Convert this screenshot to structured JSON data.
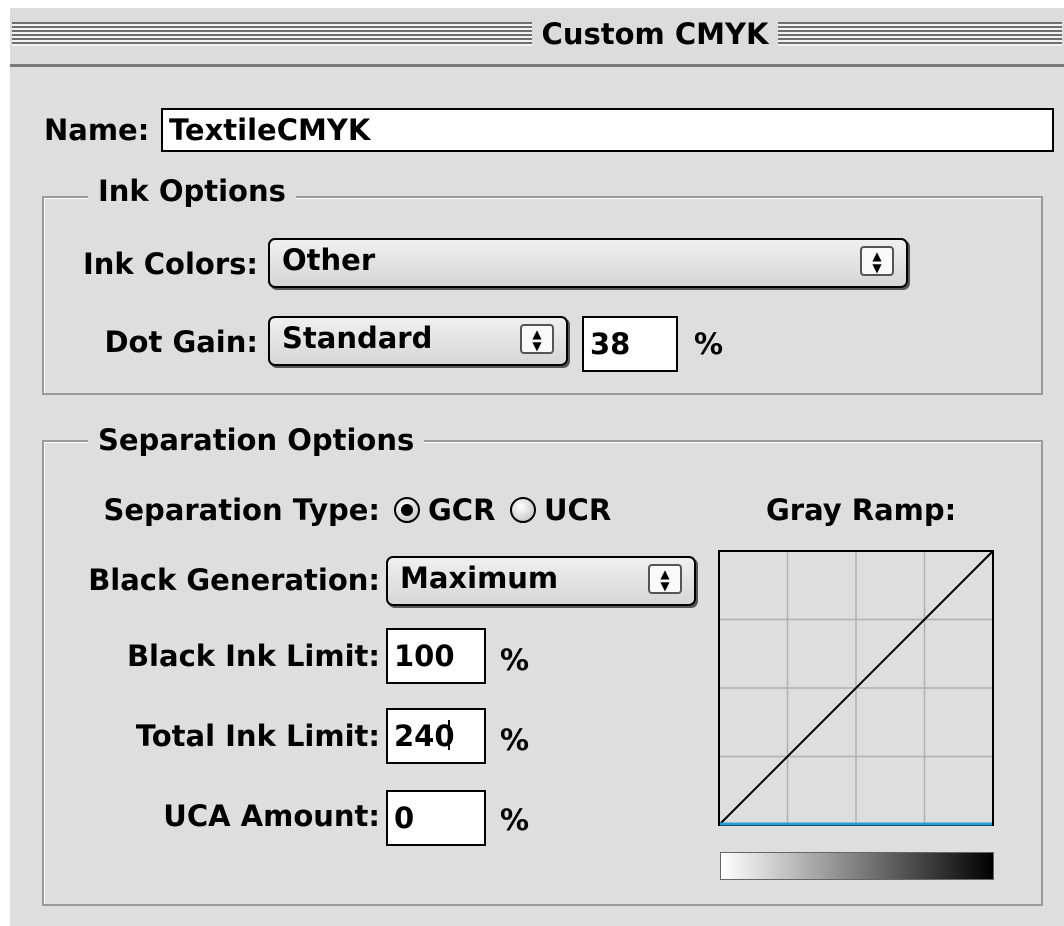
{
  "window": {
    "title": "Custom CMYK"
  },
  "name_field": {
    "label": "Name:",
    "value": "TextileCMYK"
  },
  "ink_options": {
    "legend": "Ink Options",
    "ink_colors": {
      "label": "Ink Colors:",
      "value": "Other"
    },
    "dot_gain": {
      "label": "Dot Gain:",
      "value": "Standard",
      "amount": "38",
      "unit": "%"
    }
  },
  "separation_options": {
    "legend": "Separation Options",
    "separation_type": {
      "label": "Separation Type:",
      "options": [
        "GCR",
        "UCR"
      ],
      "selected": "GCR"
    },
    "black_generation": {
      "label": "Black Generation:",
      "value": "Maximum"
    },
    "black_ink_limit": {
      "label": "Black Ink Limit:",
      "value": "100",
      "unit": "%"
    },
    "total_ink_limit": {
      "label": "Total Ink Limit:",
      "value": "240",
      "unit": "%"
    },
    "uca_amount": {
      "label": "UCA Amount:",
      "value": "0",
      "unit": "%"
    },
    "gray_ramp": {
      "label": "Gray Ramp:"
    }
  },
  "icons": {
    "popup_arrow": "up-down-arrows-icon",
    "radio": "radio-button-icon"
  },
  "colors": {
    "dialog_bg": "#dedede",
    "ramp_baseline": "#2aa0d0"
  }
}
